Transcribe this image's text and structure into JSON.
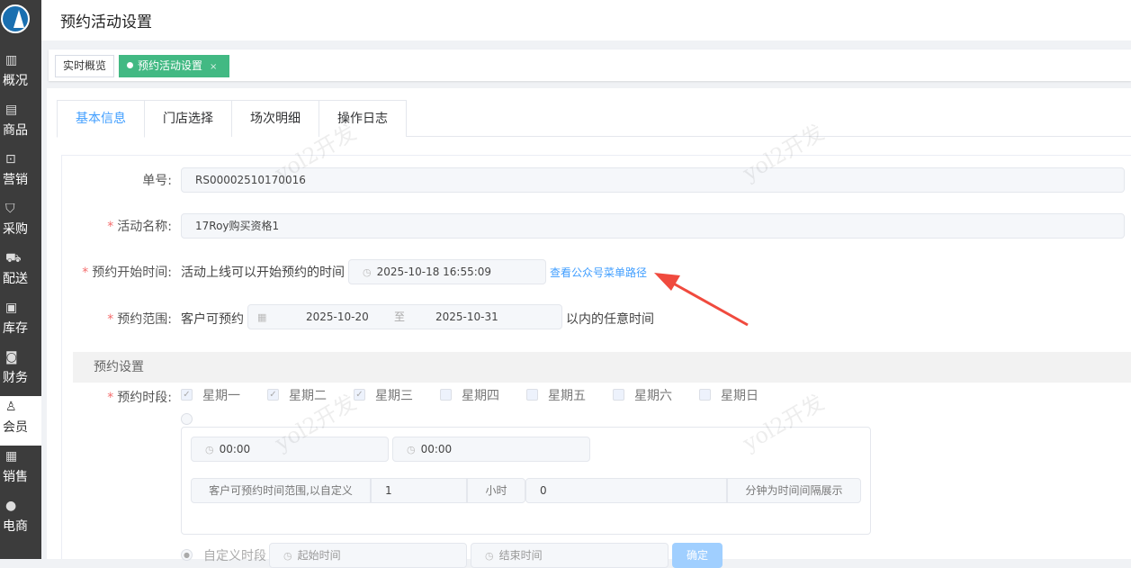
{
  "sidebar": {
    "items": [
      {
        "label": "概况",
        "icon": "building-icon"
      },
      {
        "label": "商品",
        "icon": "document-icon"
      },
      {
        "label": "营销",
        "icon": "bag-icon"
      },
      {
        "label": "采购",
        "icon": "cart-icon"
      },
      {
        "label": "配送",
        "icon": "truck-icon"
      },
      {
        "label": "库存",
        "icon": "box-icon"
      },
      {
        "label": "财务",
        "icon": "wallet-icon"
      },
      {
        "label": "会员",
        "icon": "user-icon"
      },
      {
        "label": "销售",
        "icon": "register-icon"
      },
      {
        "label": "电商",
        "icon": "person-icon"
      }
    ]
  },
  "header": {
    "title": "预约活动设置"
  },
  "tags": [
    {
      "label": "实时概览"
    },
    {
      "label": "预约活动设置",
      "close": "×"
    }
  ],
  "tabs": [
    "基本信息",
    "门店选择",
    "场次明细",
    "操作日志"
  ],
  "watermark": "yol2开发",
  "form": {
    "order_no": {
      "label": "单号:",
      "value": "RS00002510170016"
    },
    "name": {
      "label": "活动名称:",
      "value": "17Roy购买资格1"
    },
    "start": {
      "label": "预约开始时间:",
      "prefix": "活动上线可以开始预约的时间",
      "value": "2025-10-18 16:55:09",
      "link": "查看公众号菜单路径"
    },
    "range": {
      "label": "预约范围:",
      "prefix": "客户可预约",
      "from": "2025-10-20",
      "sep": "至",
      "to": "2025-10-31",
      "suffix": "以内的任意时间"
    },
    "section": "预约设置",
    "period": {
      "label": "预约时段:",
      "days": [
        {
          "label": "星期一",
          "checked": true
        },
        {
          "label": "星期二",
          "checked": true
        },
        {
          "label": "星期三",
          "checked": true
        },
        {
          "label": "星期四",
          "checked": false
        },
        {
          "label": "星期五",
          "checked": false
        },
        {
          "label": "星期六",
          "checked": false
        },
        {
          "label": "星期日",
          "checked": false
        }
      ]
    },
    "time_from": "00:00",
    "time_to": "00:00",
    "interval": {
      "prefix": "客户可预约时间范围,以自定义",
      "hours": "1",
      "hours_unit": "小时",
      "minutes": "0",
      "suffix": "分钟为时间间隔展示"
    },
    "custom": {
      "label": "自定义时段",
      "start_placeholder": "起始时间",
      "end_placeholder": "结束时间",
      "confirm": "确定"
    }
  }
}
